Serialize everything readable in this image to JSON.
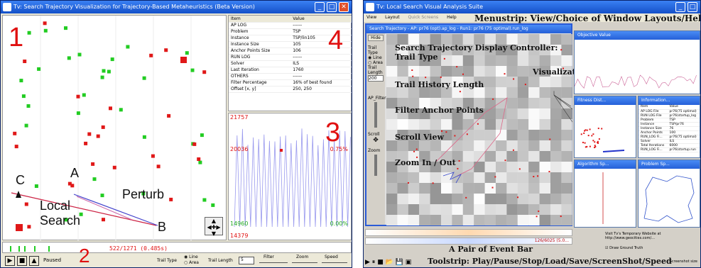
{
  "left_window": {
    "title": "Tv: Search Trajectory Visualization for Trajectory-Based Metaheuristics (Beta Version)",
    "numbers": [
      "1",
      "2",
      "3",
      "4"
    ],
    "annotations": {
      "a": "A",
      "b": "B",
      "c": "C",
      "perturb": "Perturb",
      "local": "Local",
      "search": "Search"
    },
    "properties": {
      "headers": [
        "Item",
        "Value"
      ],
      "rows": [
        [
          "AP LOG",
          "------"
        ],
        [
          "Problem",
          "TSP"
        ],
        [
          "Instance",
          "TSP/lin105"
        ],
        [
          "Instance Size",
          "105"
        ],
        [
          "Anchor Points Size",
          "106"
        ],
        [
          "RUN LOG",
          "------"
        ],
        [
          "Solver",
          "ILS"
        ],
        [
          "Last Iteration",
          "1760"
        ],
        [
          "OTHERS",
          "------"
        ],
        [
          "Filter Percentage",
          "16% of best found"
        ],
        [
          "Offset [x, y]",
          "250, 250"
        ]
      ]
    },
    "chart_labels": {
      "top_left": "21757",
      "mid_left": "20036",
      "mid_right": "0.75%",
      "low_left": "14960",
      "low_right": "0.00%",
      "bottom_left": "14379"
    },
    "progress_text": "522/1271 (0.485s)",
    "status": "Paused",
    "trail_type_label": "Trail Type",
    "trail_options": [
      "Line",
      "Area"
    ],
    "trail_length_label": "Trail Length",
    "trail_length_value": "5",
    "filter_label": "Filter",
    "zoom_label": "Zoom",
    "speed_label": "Speed"
  },
  "right_window": {
    "title": "Tv: Local Search Visual Analysis Suite",
    "menu": [
      "View",
      "Layout",
      "Quick Screens",
      "Help"
    ],
    "inner_title": "Search Trajectory - AP: pr76 (opt).ap_log - Run1: pr76 (75 optimal).run_log",
    "hide_button": "Hide",
    "side_labels": {
      "trail_type": "Trail Type",
      "line": "Line",
      "area": "Area",
      "trail_length": "Trail Length",
      "trail_length_value": "200",
      "ap_filter": "AP_Filter",
      "scroll": "Scroll",
      "zoom": "Zoom"
    },
    "annotations": {
      "menustrip": "Menustrip: View/Choice of Window Layouts/Help",
      "controller": "Search Trajectory Display Controller:",
      "trail_type": "Trail Type",
      "trail_history": "Trail History Length",
      "filter": "Filter Anchor Points",
      "scroll": "Scroll View",
      "zoom": "Zoom In / Out",
      "vis_windows": "Visualization Windows",
      "event_bar": "A Pair of Event Bar",
      "toolstrip": "Toolstrip: Play/Pause/Stop/Load/Save/ScreenShot/Speed"
    },
    "mini_windows": [
      "Objective Value",
      "Fitness Dist...",
      "Information...",
      "Algorithm Sp...",
      "Problem Sp..."
    ],
    "info_rows": [
      [
        "Item",
        "Value"
      ],
      [
        "AP LOG File",
        "pr76(75 optimal)"
      ],
      [
        "RUN LOG File",
        "pr76(startup_log"
      ],
      [
        "Problem",
        "TSP"
      ],
      [
        "Instance",
        "TSP/pr76"
      ],
      [
        "Instance Size",
        "76"
      ],
      [
        "Anchor Points",
        "100"
      ],
      [
        "RUN_LOG Fi...",
        "pr76(75 optimal)"
      ],
      [
        "Solver",
        "ILS"
      ],
      [
        "Total Iterations",
        "6000"
      ],
      [
        "RUN_LOG Fi...",
        "pr76(startup.run"
      ]
    ],
    "event_text": "126/6025 (5.0...",
    "website_text": "Visit Tv's Temporary Website at http://www.geocities.com/...",
    "checkbox_label": "Draw Ground Truth",
    "screenshot_label": "Screenshot size"
  },
  "colors": {
    "title_blue": "#1450c8",
    "point_red": "#e01818",
    "point_green": "#22cc22",
    "annotation_red": "#e01010",
    "trend_blue": "#9999ee"
  }
}
